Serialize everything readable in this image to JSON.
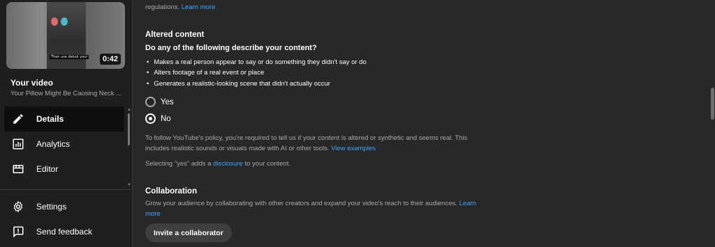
{
  "sidebar": {
    "thumbnail": {
      "duration": "0:42",
      "caption": "Then use dakuk your"
    },
    "your_video_label": "Your video",
    "video_title": "Your Pillow Might Be Causing Neck ...",
    "items": [
      {
        "label": "Details",
        "icon": "pencil-icon",
        "active": true
      },
      {
        "label": "Analytics",
        "icon": "analytics-icon",
        "active": false
      },
      {
        "label": "Editor",
        "icon": "editor-icon",
        "active": false
      }
    ],
    "footer": [
      {
        "label": "Settings",
        "icon": "gear-icon"
      },
      {
        "label": "Send feedback",
        "icon": "feedback-icon"
      }
    ]
  },
  "main": {
    "top_note": {
      "text": "regulations.",
      "link": "Learn more"
    },
    "altered": {
      "heading": "Altered content",
      "question": "Do any of the following describe your content?",
      "bullets": [
        "Makes a real person appear to say or do something they didn't say or do",
        "Alters footage of a real event or place",
        "Generates a realistic-looking scene that didn't actually occur"
      ],
      "options": {
        "yes": "Yes",
        "no": "No",
        "selected": "No"
      },
      "policy_line1": "To follow YouTube's policy, you're required to tell us if your content is altered or synthetic and seems real. This",
      "policy_line2": "includes realistic sounds or visuals made with AI or other tools.",
      "policy_link": "View examples",
      "disclosure_pre": "Selecting \"yes\" adds a",
      "disclosure_link": "disclosure",
      "disclosure_post": "to your content."
    },
    "collab": {
      "heading": "Collaboration",
      "text": "Grow your audience by collaborating with other creators and expand your video's reach to their audiences.",
      "link_part1": "Learn",
      "link_part2": "more",
      "button": "Invite a collaborator"
    }
  },
  "colors": {
    "background": "#282828",
    "sidebar": "#1f1f1f",
    "link": "#3ea6ff",
    "active_item": "#0f0f0f"
  }
}
